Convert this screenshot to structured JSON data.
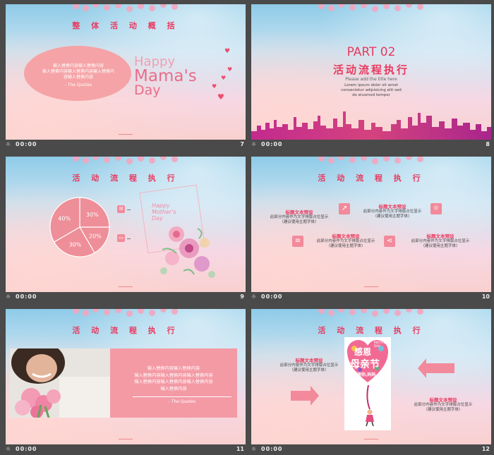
{
  "slides": [
    {
      "number": "7",
      "time": "00:00",
      "title": "整 体 活 动 概 括",
      "ellipse_lines": [
        "输入替换内容输入替换内容",
        "输入替换内容输入替换内容输入替换内",
        "容输入替换内容"
      ],
      "quote": "- The Quotes",
      "happy_line1": "Happy",
      "happy_line2": "Mama's",
      "happy_line3": "Day"
    },
    {
      "number": "8",
      "time": "00:00",
      "part": "PART 02",
      "title": "活动流程执行",
      "subtitle": "Please add the title here",
      "small_lines": [
        "Lorem ipsum dolor sit amet",
        "consectetur adipisicing elit sed",
        "do eiusmod tempor"
      ]
    },
    {
      "number": "9",
      "time": "00:00",
      "title": "活 动 流 程 执 行",
      "pie": {
        "type": "pie",
        "slices": [
          {
            "label": "30%",
            "value": 30
          },
          {
            "label": "20%",
            "value": 20
          },
          {
            "label": "30%",
            "value": 30
          },
          {
            "label": "40%",
            "value": 40
          }
        ]
      },
      "card_line1": "Happy",
      "card_line2": "Mother's",
      "card_line3": "Day"
    },
    {
      "number": "10",
      "time": "00:00",
      "title": "活 动 流 程 执 行",
      "blocks": [
        {
          "heading": "标题文本预设",
          "lines": [
            "此部分内容作为文字排版占位显示",
            "（建议使用主题字体）"
          ]
        },
        {
          "heading": "标题文本预设",
          "lines": [
            "此部分内容作为文字排版占位显示",
            "（建议使用主题字体）"
          ]
        },
        {
          "heading": "标题文本预设",
          "lines": [
            "此部分内容作为文字排版占位显示",
            "（建议使用主题字体）"
          ]
        },
        {
          "heading": "标题文本预设",
          "lines": [
            "此部分内容作为文字排版占位显示",
            "（建议使用主题字体）"
          ]
        }
      ]
    },
    {
      "number": "11",
      "time": "00:00",
      "title": "活 动 流 程 执 行",
      "box_lines": [
        "输入替换内容输入替换内容",
        "输入替换内容输入替换内容输入替换内容",
        "输入替换内容输入替换内容输入替换内容",
        "输入替换内容"
      ],
      "quote": "- The Quotes"
    },
    {
      "number": "12",
      "time": "00:00",
      "title": "活 动 流 程 执 行",
      "left_heading": "标题文本预设",
      "left_lines": [
        "此部分内容作为文字排版占位显示",
        "（建议使用主题字体）"
      ],
      "right_heading": "标题文本预设",
      "right_lines": [
        "此部分内容作为文字排版占位显示",
        "（建议使用主题字体）"
      ],
      "poster_line1": "感恩",
      "poster_line2": "母亲节",
      "poster_en": "MOTHER'S DAY",
      "poster_tag": "谢谢你,妈妈"
    }
  ],
  "colors": {
    "accent": "#e83a5f",
    "pink": "#f28a9b",
    "bg": "#4a4a4a"
  }
}
